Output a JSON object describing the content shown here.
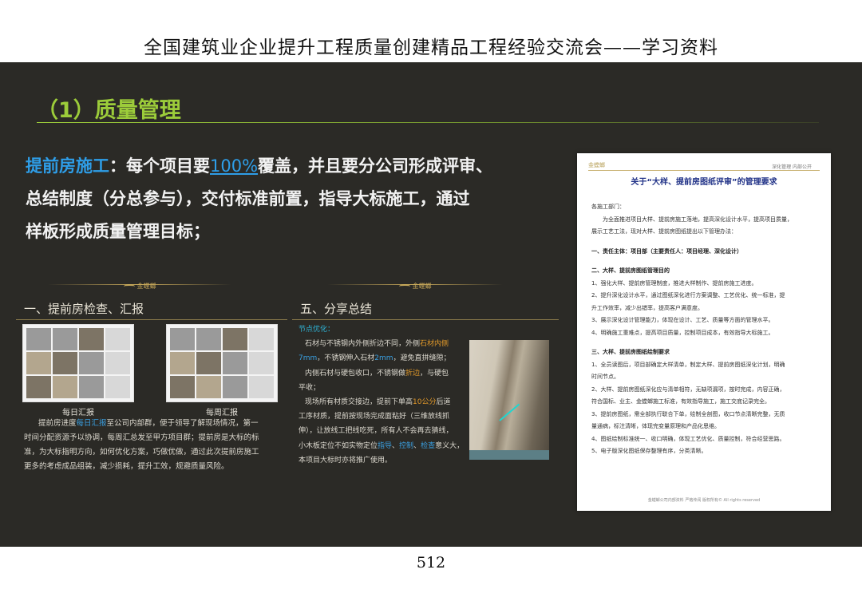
{
  "header": {
    "title": "全国建筑业企业提升工程质量创建精品工程经验交流会——学习资料"
  },
  "slide": {
    "title": "（1）质量管理",
    "intro": {
      "highlight": "提前房施工",
      "colon": "：每个项目要",
      "percent": "100%",
      "line1_rest": "覆盖，并且要分公司形成评审、",
      "line2": "总结制度（分总参与），交付标准前置，指导大标施工，通过",
      "line3": "样板形成质量管理目标；"
    },
    "left_panel": {
      "logo": "金螳螂",
      "heading": "一、提前房检查、汇报",
      "captions": [
        "每日汇报",
        "每周汇报"
      ],
      "text_pre": "提前房进度",
      "text_link": "每日汇报",
      "text_rest1": "至公司内部群，便于领导了解现场情况，第一",
      "text_line2": "时间分配资源予以协调，每周汇总发至甲方项目群；提前房是大标的标",
      "text_line3": "准，为大标指明方向，如何优化方案，巧做优做，通过此次提前房施工",
      "text_line4": "更多的考虑成品组装，减少损耗，提升工效，规避质量风险。"
    },
    "right_panel": {
      "logo": "金螳螂",
      "heading": "五、分享总结",
      "node_title": "节点优化：",
      "l1_pre": "石材与不锈钢内外侧折边不同，外侧",
      "l1_hl": "石材内侧",
      "l2_hl": "7mm",
      "l2_mid": "，不锈钢伸入石材",
      "l2_hl2": "2mm",
      "l2_rest": "，避免直拼缝隙；",
      "l3_pre": "内侧石材与硬包收口，不锈钢做",
      "l3_hl": "折边",
      "l3_rest": "，与硬包",
      "l4": "平收；",
      "l5_pre": "现场所有材质交接边，提前下单高",
      "l5_hl": "10公分",
      "l5_rest": "后道",
      "l6": "工序材质，提前按现场完成面粘好（三维放线抓",
      "l7": "伸），让放线工把线吃死，所有人不会再去猜线，",
      "l8_pre": "小木板定位不如实物定位",
      "l8_hl1": "指导",
      "l8_c1": "、",
      "l8_hl2": "控制",
      "l8_c2": "、",
      "l8_hl3": "检查",
      "l8_rest": "意义大，",
      "l9": "本项目大标时亦将推广使用。"
    },
    "document": {
      "top_logo": "金螳螂",
      "top_right": "深化管理    内部公开",
      "title": "关于“大样、提前房图纸评审”的管理要求",
      "salutation": "各施工部门：",
      "intro1": "为全面推进项目大样、提前房施工落地，提高深化设计水平，提高项目质量，",
      "intro2": "展示工艺工法，现对大样、提前房图纸提出以下管理办法：",
      "sec1": "一、责任主体：项目部（主要责任人：项目经理、深化设计）",
      "sec2": "二、大样、提前房图纸管理目的",
      "s2_1": "1、强化大样、提前房管理制度，推进大样制作、提前房施工进度。",
      "s2_2a": "2、提升深化设计水平，通过图纸深化进行方案调整、工艺优化、统一标准，提",
      "s2_2b": "升工作效率，减少出错率，提高客户满意度。",
      "s2_3": "3、展示深化设计管理能力，体现在设计、工艺、质量等方面的管理水平。",
      "s2_4": "4、明确施工重难点，提高项目质量，控制项目成本，有效指导大标施工。",
      "sec3": "三、大样、提前房图纸绘制要求",
      "s3_1a": "1、全员读图后，项目部确定大样清单，制定大样、提前房图纸深化计划，明确",
      "s3_1b": "时间节点。",
      "s3_2a": "2、大样、提前房图纸深化应与清单相符，无缺项漏项，按时完成，内容正确，",
      "s3_2b": "符合国标、业主、金螳螂施工标准，有效指导施工，施工交底记录完全。",
      "s3_3a": "3、提前房图纸，需全部执行联合下单，绘制全剖图，收口节点清晰完整，无质",
      "s3_3b": "量通病，标注清晰，体现完变量原理和产品化思维。",
      "s3_4": "4、图纸绘制标准统一、收口明确，体现工艺优化、质量控制，符合经营思路。",
      "s3_5": "5、电子版深化图纸保存整理有序，分类清晰。",
      "footer": "金螳螂公司内部资料  严格传阅  版权所有© All rights reserved"
    }
  },
  "footer": {
    "page_number": "512"
  }
}
